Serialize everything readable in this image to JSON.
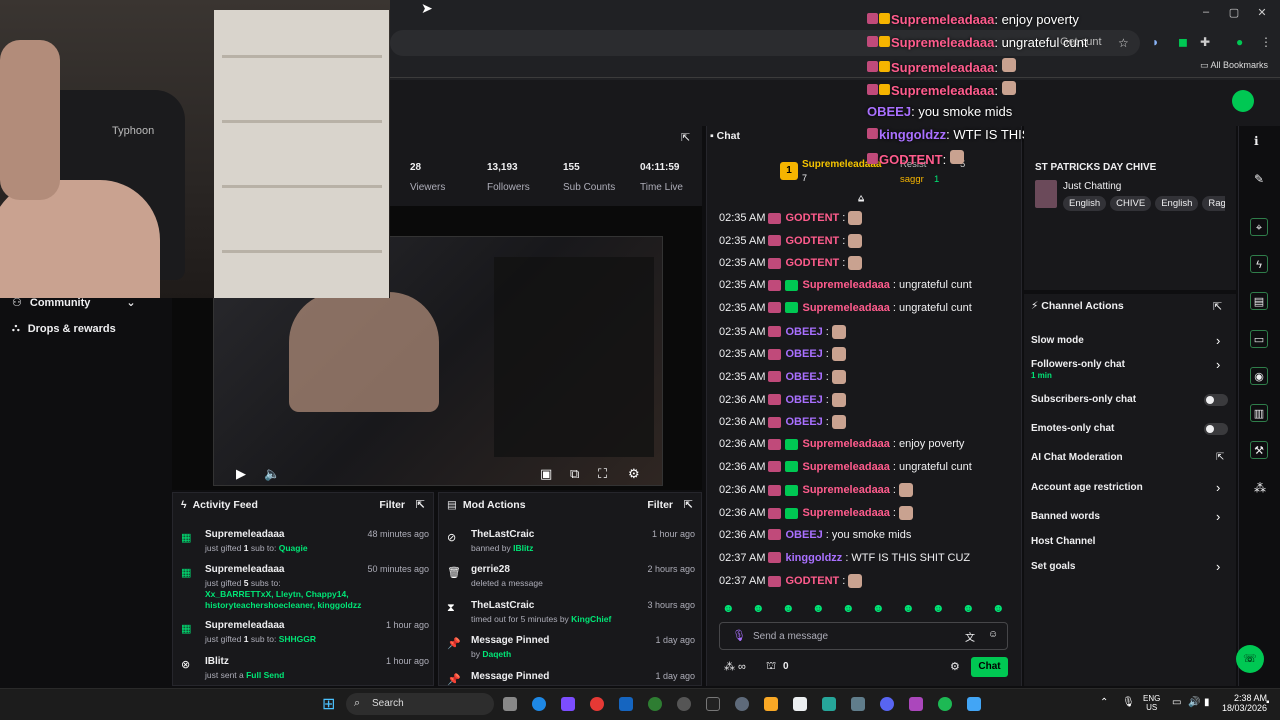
{
  "browser": {
    "bookmarks_label": "All Bookmarks",
    "address_suffix": "Get cunt"
  },
  "sidebar": {
    "items": [
      {
        "label": "Community",
        "icon": "community-icon"
      },
      {
        "label": "Drops & rewards",
        "icon": "gift-icon"
      }
    ]
  },
  "webcam": {
    "brand": "Typhoon"
  },
  "stats": [
    {
      "value": "28",
      "label": "Viewers"
    },
    {
      "value": "13,193",
      "label": "Followers"
    },
    {
      "value": "155",
      "label": "Sub Counts"
    },
    {
      "value": "04:11:59",
      "label": "Time Live"
    }
  ],
  "activity": {
    "title": "Activity Feed",
    "filter": "Filter",
    "rows": [
      {
        "name": "Supremeleadaaa",
        "time": "48 minutes ago",
        "pre": "just gifted ",
        "count": "1",
        "mid": " sub to: ",
        "target": "Quagie"
      },
      {
        "name": "Supremeleadaaa",
        "time": "50 minutes ago",
        "pre": "just gifted ",
        "count": "5",
        "mid": " subs to:",
        "target": "Xx_BARRETTxX, Lleytn, Chappy14, historyteachershoecleaner, kinggoldzz"
      },
      {
        "name": "Supremeleadaaa",
        "time": "1 hour ago",
        "pre": "just gifted ",
        "count": "1",
        "mid": " sub to: ",
        "target": "SHHGGR"
      },
      {
        "name": "IBlitz",
        "time": "1 hour ago",
        "pre": "just sent a ",
        "count": "",
        "mid": "",
        "target": "Full Send"
      }
    ]
  },
  "mod": {
    "title": "Mod Actions",
    "filter": "Filter",
    "rows": [
      {
        "name": "TheLastCraic",
        "time": "1 hour ago",
        "pre": "banned by ",
        "target": "IBlitz",
        "icon": "ban-icon"
      },
      {
        "name": "gerrie28",
        "time": "2 hours ago",
        "pre": "deleted a message",
        "target": "",
        "icon": "trash-icon"
      },
      {
        "name": "TheLastCraic",
        "time": "3 hours ago",
        "pre": "timed out for 5 minutes by ",
        "target": "KingChief",
        "icon": "hourglass-icon"
      },
      {
        "name": "Message Pinned",
        "time": "1 day ago",
        "pre": "by ",
        "target": "Daqeth",
        "icon": "pin-icon"
      },
      {
        "name": "Message Pinned",
        "time": "1 day ago",
        "pre": "",
        "target": "",
        "icon": "pin-icon"
      }
    ]
  },
  "chat": {
    "title": "Chat",
    "top_gifter": {
      "rank": "1",
      "name": "Supremeleadaaa",
      "count": "7"
    },
    "second": {
      "name": "Resist",
      "count": "5"
    },
    "third": {
      "name": "saggr",
      "count": "1"
    },
    "messages": [
      {
        "time": "02:35 AM",
        "user": "GODTENT",
        "color": "pink",
        "text": ""
      },
      {
        "time": "02:35 AM",
        "user": "GODTENT",
        "color": "pink",
        "text": ""
      },
      {
        "time": "02:35 AM",
        "user": "GODTENT",
        "color": "pink",
        "text": ""
      },
      {
        "time": "02:35 AM",
        "user": "Supremeleadaaa",
        "color": "pink",
        "text": "ungrateful cunt"
      },
      {
        "time": "02:35 AM",
        "user": "Supremeleadaaa",
        "color": "pink",
        "text": "ungrateful cunt"
      },
      {
        "time": "02:35 AM",
        "user": "OBEEJ",
        "color": "purple",
        "text": ""
      },
      {
        "time": "02:35 AM",
        "user": "OBEEJ",
        "color": "purple",
        "text": ""
      },
      {
        "time": "02:35 AM",
        "user": "OBEEJ",
        "color": "purple",
        "text": ""
      },
      {
        "time": "02:36 AM",
        "user": "OBEEJ",
        "color": "purple",
        "text": ""
      },
      {
        "time": "02:36 AM",
        "user": "OBEEJ",
        "color": "purple",
        "text": ""
      },
      {
        "time": "02:36 AM",
        "user": "Supremeleadaaa",
        "color": "pink",
        "text": "enjoy poverty"
      },
      {
        "time": "02:36 AM",
        "user": "Supremeleadaaa",
        "color": "pink",
        "text": "ungrateful cunt"
      },
      {
        "time": "02:36 AM",
        "user": "Supremeleadaaa",
        "color": "pink",
        "text": ""
      },
      {
        "time": "02:36 AM",
        "user": "Supremeleadaaa",
        "color": "pink",
        "text": ""
      },
      {
        "time": "02:36 AM",
        "user": "OBEEJ",
        "color": "purple",
        "text": "you smoke mids"
      },
      {
        "time": "02:37 AM",
        "user": "kinggoldzz",
        "color": "purple",
        "text": "WTF IS THIS SHIT CUZ"
      },
      {
        "time": "02:37 AM",
        "user": "GODTENT",
        "color": "pink",
        "text": ""
      }
    ],
    "input_placeholder": "Send a message",
    "points": "0",
    "chat_button": "Chat"
  },
  "overlay_chat": [
    {
      "user": "Supremeleadaaa",
      "color": "pink",
      "text": "enjoy poverty"
    },
    {
      "user": "Supremeleadaaa",
      "color": "pink",
      "text": "ungrateful cunt"
    },
    {
      "user": "Supremeleadaaa",
      "color": "pink",
      "text": ""
    },
    {
      "user": "Supremeleadaaa",
      "color": "pink",
      "text": ""
    },
    {
      "user": "OBEEJ",
      "color": "purple",
      "text": "you smoke mids"
    },
    {
      "user": "kinggoldzz",
      "color": "purple",
      "text": "WTF IS THIS SHIT CUZ"
    },
    {
      "user": "GODTENT",
      "color": "pink",
      "text": ""
    }
  ],
  "stream_info": {
    "title": "ST PATRICKS DAY CHIVE",
    "category": "Just Chatting",
    "tags": [
      "English",
      "CHIVE",
      "English",
      "Rag"
    ]
  },
  "channel_actions": {
    "title": "Channel Actions",
    "rows": [
      {
        "label": "Slow mode",
        "kind": "chevron",
        "sub": ""
      },
      {
        "label": "Followers-only chat",
        "kind": "chevron",
        "sub": "1 min"
      },
      {
        "label": "Subscribers-only chat",
        "kind": "toggle",
        "sub": ""
      },
      {
        "label": "Emotes-only chat",
        "kind": "toggle",
        "sub": ""
      },
      {
        "label": "AI Chat Moderation",
        "kind": "external",
        "sub": ""
      },
      {
        "label": "Account age restriction",
        "kind": "chevron",
        "sub": ""
      },
      {
        "label": "Banned words",
        "kind": "chevron",
        "sub": ""
      },
      {
        "label": "Host Channel",
        "kind": "none",
        "sub": ""
      },
      {
        "label": "Set goals",
        "kind": "chevron",
        "sub": ""
      }
    ]
  },
  "taskbar": {
    "search": "Search",
    "lang_top": "ENG",
    "lang_bottom": "US",
    "time": "2:38 AM",
    "date": "18/03/2026"
  },
  "colors": {
    "accent": "#00c853",
    "pink": "#ff5c8d",
    "purple": "#a970ff",
    "panel": "#18181b",
    "bg": "#0e0e10"
  }
}
